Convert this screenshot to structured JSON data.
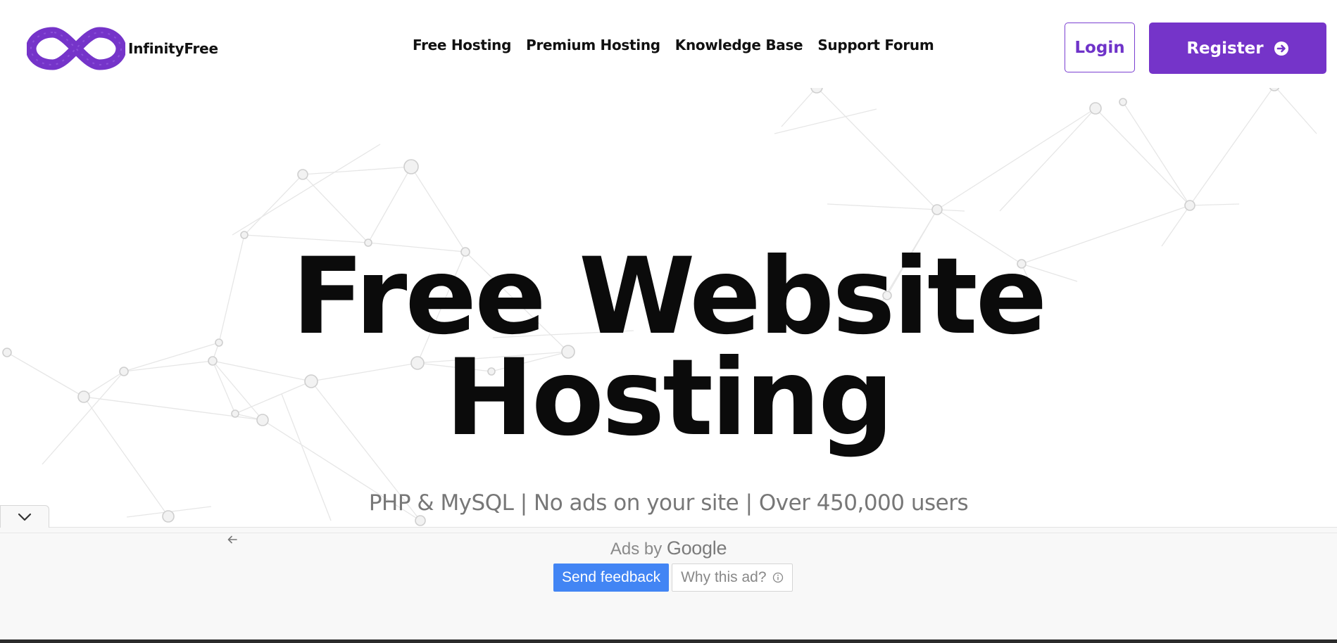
{
  "brand": {
    "name": "InfinityFree",
    "logo_icon": "infinity-icon",
    "accent_color": "#7534c9"
  },
  "nav": {
    "links": [
      "Free Hosting",
      "Premium Hosting",
      "Knowledge Base",
      "Support Forum"
    ],
    "login_label": "Login",
    "register_label": "Register",
    "register_icon": "arrow-circle-right-icon"
  },
  "hero": {
    "title_line1": "Free Website",
    "title_line2": "Hosting",
    "subtitle": "PHP & MySQL | No ads on your site | Over 450,000 users"
  },
  "ad_bar": {
    "ads_by": "Ads by",
    "google": "Google",
    "send_feedback": "Send feedback",
    "why_this_ad": "Why this ad?",
    "feedback_color": "#4285f4"
  }
}
